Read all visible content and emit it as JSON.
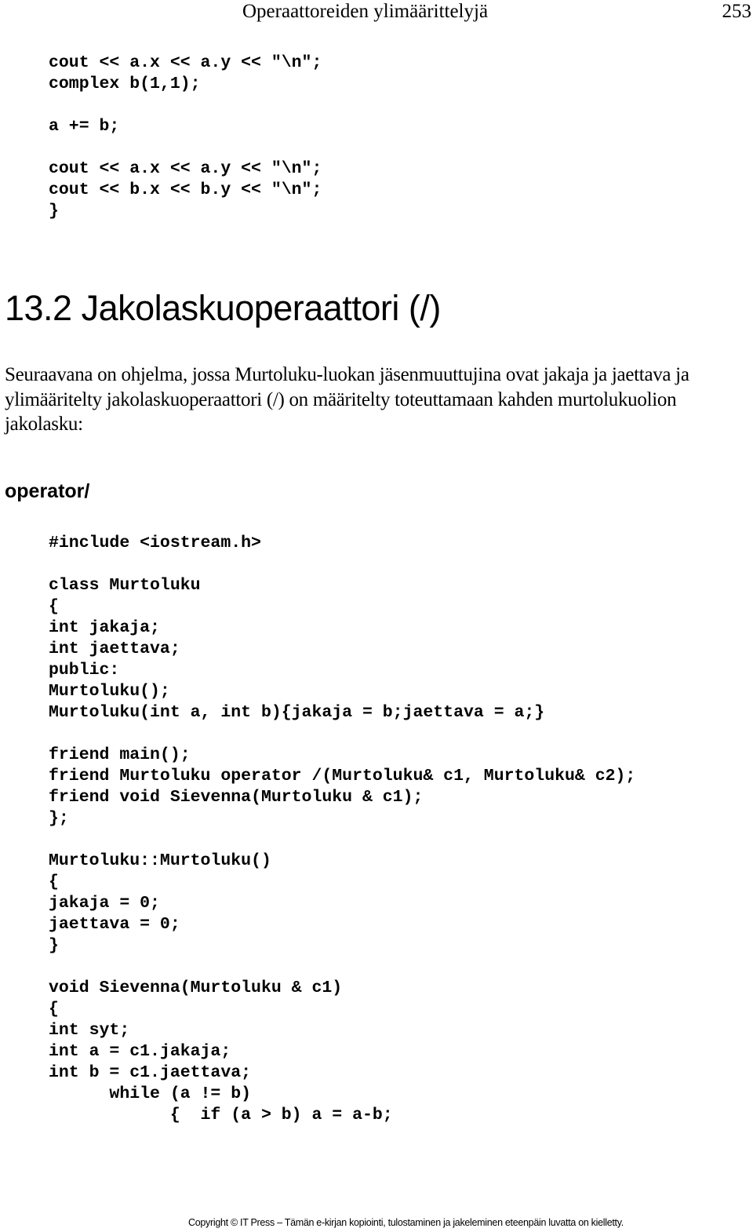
{
  "header": {
    "chapter_title": "Operaattoreiden ylimäärittelyjä",
    "page_number": "253"
  },
  "code_block_1": [
    "cout << a.x << a.y << \"\\n\";",
    "complex b(1,1);",
    "",
    "a += b;",
    "",
    "cout << a.x << a.y << \"\\n\";",
    "cout << b.x << b.y << \"\\n\";",
    "}"
  ],
  "section": {
    "title": "13.2 Jakolaskuoperaattori (/)",
    "intro": "Seuraavana on ohjelma, jossa Murtoluku-luokan jäsenmuuttujina ovat jakaja ja jaettava ja ylimääritelty jakolaskuoperaattori (/) on määritelty toteuttamaan kahden murtolukuolion jakolasku:",
    "subheading": "operator/"
  },
  "code_block_2": [
    "#include <iostream.h>",
    "",
    "class Murtoluku",
    "{",
    "int jakaja;",
    "int jaettava;",
    "public:",
    "Murtoluku();",
    "Murtoluku(int a, int b){jakaja = b;jaettava = a;}",
    "",
    "friend main();",
    "friend Murtoluku operator /(Murtoluku& c1, Murtoluku& c2);",
    "friend void Sievenna(Murtoluku & c1);",
    "};",
    "",
    "Murtoluku::Murtoluku()",
    "{",
    "jakaja = 0;",
    "jaettava = 0;",
    "}",
    "",
    "void Sievenna(Murtoluku & c1)",
    "{",
    "int syt;",
    "int a = c1.jakaja;",
    "int b = c1.jaettava;",
    "      while (a != b)",
    "            {  if (a > b) a = a-b;"
  ],
  "footer": {
    "copyright": "Copyright © IT Press – Tämän e-kirjan kopiointi, tulostaminen ja jakeleminen eteenpäin luvatta on kielletty."
  }
}
